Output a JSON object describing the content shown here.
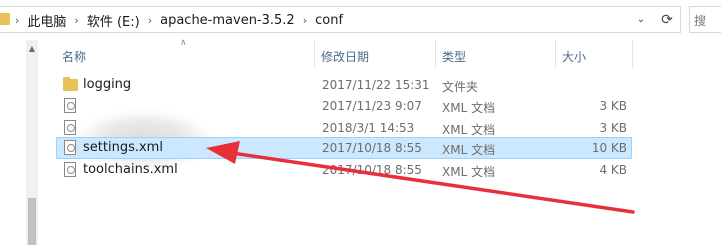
{
  "breadcrumb": {
    "items": [
      "此电脑",
      "软件 (E:)",
      "apache-maven-3.5.2",
      "conf"
    ]
  },
  "search": {
    "placeholder": "搜"
  },
  "columns": {
    "name": "名称",
    "modified": "修改日期",
    "type": "类型",
    "size": "大小"
  },
  "files": [
    {
      "name": "logging",
      "modified": "2017/11/22 15:31",
      "type": "文件夹",
      "size": "",
      "icon": "folder-icon"
    },
    {
      "name": "",
      "modified": "2017/11/23 9:07",
      "type": "XML 文档",
      "size": "3 KB",
      "icon": "xml-file-icon"
    },
    {
      "name": "",
      "modified": "2018/3/1 14:53",
      "type": "XML 文档",
      "size": "3 KB",
      "icon": "xml-file-icon"
    },
    {
      "name": "settings.xml",
      "modified": "2017/10/18 8:55",
      "type": "XML 文档",
      "size": "10 KB",
      "icon": "xml-file-icon",
      "selected": true
    },
    {
      "name": "toolchains.xml",
      "modified": "2017/10/18 8:55",
      "type": "XML 文档",
      "size": "4 KB",
      "icon": "xml-file-icon"
    }
  ],
  "annotation": {
    "color": "#e8303a"
  },
  "colors": {
    "selection": "#cce8ff",
    "selection_border": "#99d1ff",
    "header_text": "#4d6a8a"
  }
}
